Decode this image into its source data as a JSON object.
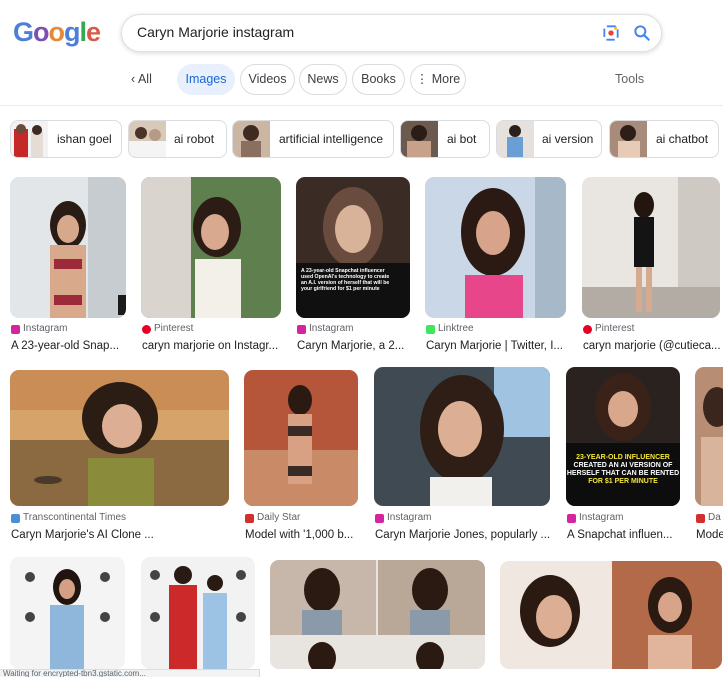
{
  "logo": {
    "l1": "G",
    "l2": "o",
    "l3": "o",
    "l4": "g",
    "l5": "l",
    "l6": "e"
  },
  "search": {
    "query": "Caryn Marjorie instagram"
  },
  "tabs": {
    "all": "All",
    "images": "Images",
    "videos": "Videos",
    "news": "News",
    "books": "Books",
    "more": "More",
    "tools": "Tools"
  },
  "chips": [
    {
      "label": "ishan goel"
    },
    {
      "label": "ai robot"
    },
    {
      "label": "artificial intelligence"
    },
    {
      "label": "ai bot"
    },
    {
      "label": "ai version"
    },
    {
      "label": "ai chatbot"
    }
  ],
  "results": [
    {
      "source": "Instagram",
      "caption": "A 23-year-old Snap..."
    },
    {
      "source": "Pinterest",
      "caption": "caryn marjorie on Instagr..."
    },
    {
      "source": "Instagram",
      "caption": "Caryn Marjorie, a 2..."
    },
    {
      "source": "Linktree",
      "caption": "Caryn Marjorie | Twitter, I..."
    },
    {
      "source": "Pinterest",
      "caption": "caryn marjorie (@cutieca..."
    },
    {
      "source": "Transcontinental Times",
      "caption": "Caryn Marjorie's AI Clone ..."
    },
    {
      "source": "Daily Star",
      "caption": "Model with '1,000 b..."
    },
    {
      "source": "Instagram",
      "caption": "Caryn Marjorie Jones, popularly ..."
    },
    {
      "source": "Instagram",
      "caption": "A Snapchat influen..."
    },
    {
      "source": "Da",
      "caption": "Mode"
    }
  ],
  "overlays": {
    "snapchat_text": "A 23-year-old Snapchat influencer used OpenAI's technology to create an A.I. version of herself that will be your girlfriend for $1 per minute",
    "l1": "23-YEAR-OLD INFLUENCER",
    "l2": "CREATED AN AI VERSION OF",
    "l3": "HERSELF THAT CAN BE RENTED",
    "l4": "FOR $1 PER MINUTE"
  },
  "status": "Waiting for encrypted-tbn3.gstatic.com..."
}
